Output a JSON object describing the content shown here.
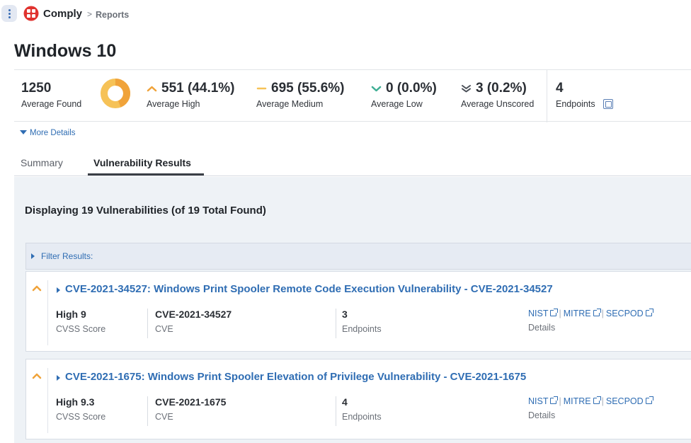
{
  "app": {
    "name": "Comply",
    "breadcrumb_sep": ">",
    "breadcrumb": "Reports"
  },
  "page_title": "Windows 10",
  "stats": {
    "found": {
      "value": "1250",
      "label": "Average Found"
    },
    "high": {
      "value": "551 (44.1%)",
      "label": "Average High"
    },
    "medium": {
      "value": "695 (55.6%)",
      "label": "Average Medium"
    },
    "low": {
      "value": "0 (0.0%)",
      "label": "Average Low"
    },
    "unscored": {
      "value": "3 (0.2%)",
      "label": "Average Unscored"
    },
    "endpoints": {
      "value": "4",
      "label": "Endpoints"
    }
  },
  "severity_distribution": {
    "high": 0.441,
    "medium": 0.556,
    "low": 0.0,
    "unscored": 0.002
  },
  "colors": {
    "high": "#f0a33a",
    "medium": "#f6c257",
    "low": "#3fae94",
    "link": "#2f6db3"
  },
  "more_details": "More Details",
  "tabs": [
    {
      "label": "Summary",
      "active": false
    },
    {
      "label": "Vulnerability Results",
      "active": true
    }
  ],
  "results": {
    "title": "Displaying 19 Vulnerabilities (of 19 Total Found)",
    "filter_label": "Filter Results:"
  },
  "vulnerabilities": [
    {
      "title": "CVE-2021-34527: Windows Print Spooler Remote Code Execution Vulnerability - CVE-2021-34527",
      "score": "High 9",
      "score_label": "CVSS Score",
      "cve": "CVE-2021-34527",
      "cve_label": "CVE",
      "endpoints": "3",
      "endpoints_label": "Endpoints",
      "links": [
        "NIST",
        "MITRE",
        "SECPOD"
      ],
      "links_sep": "|",
      "details_label": "Details"
    },
    {
      "title": "CVE-2021-1675: Windows Print Spooler Elevation of Privilege Vulnerability - CVE-2021-1675",
      "score": "High 9.3",
      "score_label": "CVSS Score",
      "cve": "CVE-2021-1675",
      "cve_label": "CVE",
      "endpoints": "4",
      "endpoints_label": "Endpoints",
      "links": [
        "NIST",
        "MITRE",
        "SECPOD"
      ],
      "links_sep": "|",
      "details_label": "Details"
    }
  ]
}
